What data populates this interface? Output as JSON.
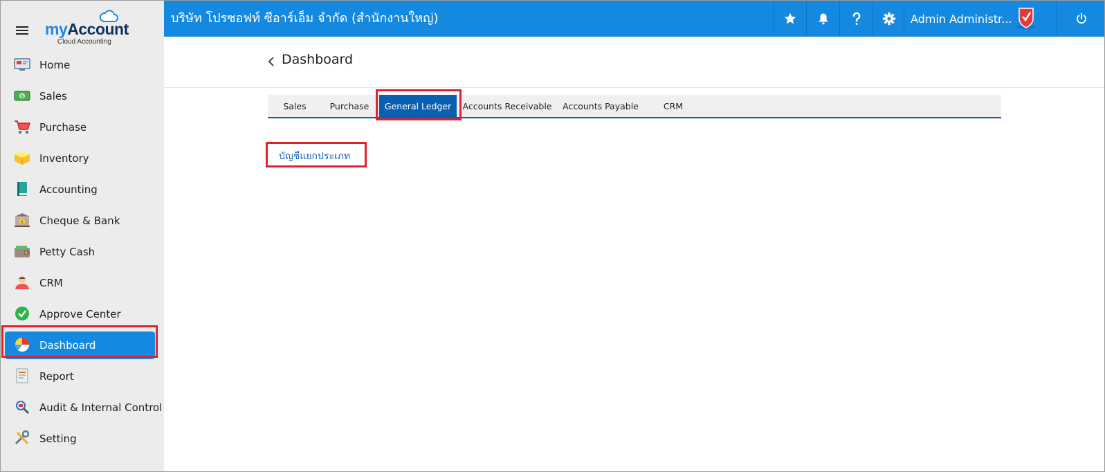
{
  "app": {
    "logo_my": "my",
    "logo_account": "Account",
    "logo_subtitle": "Cloud Accounting"
  },
  "topbar": {
    "company_name": "บริษัท โปรซอฟท์ ซีอาร์เอ็ม จำกัด (สำนักงานใหญ่)",
    "user_name": "Admin Administr...",
    "icons": [
      "star-icon",
      "bell-icon",
      "help-icon",
      "gear-icon",
      "power-icon"
    ]
  },
  "sidebar": {
    "items": [
      {
        "label": "Home",
        "icon": "home-icon"
      },
      {
        "label": "Sales",
        "icon": "money-icon"
      },
      {
        "label": "Purchase",
        "icon": "cart-icon"
      },
      {
        "label": "Inventory",
        "icon": "box-icon"
      },
      {
        "label": "Accounting",
        "icon": "book-icon"
      },
      {
        "label": "Cheque & Bank",
        "icon": "bank-icon"
      },
      {
        "label": "Petty Cash",
        "icon": "wallet-icon"
      },
      {
        "label": "CRM",
        "icon": "person-icon"
      },
      {
        "label": "Approve Center",
        "icon": "check-circle-icon"
      },
      {
        "label": "Dashboard",
        "icon": "pie-chart-icon",
        "active": true
      },
      {
        "label": "Report",
        "icon": "report-icon"
      },
      {
        "label": "Audit & Internal Control",
        "icon": "magnifier-icon"
      },
      {
        "label": "Setting",
        "icon": "tools-icon"
      }
    ]
  },
  "main": {
    "title": "Dashboard",
    "tabs": [
      {
        "label": "Sales"
      },
      {
        "label": "Purchase"
      },
      {
        "label": "General Ledger",
        "active": true
      },
      {
        "label": "Accounts Receivable"
      },
      {
        "label": "Accounts Payable"
      },
      {
        "label": "CRM"
      }
    ],
    "links": [
      {
        "label": "บัญชีแยกประเภท"
      }
    ]
  },
  "colors": {
    "accent": "#1589e0",
    "tab_active": "#0a5fb0",
    "highlight": "#e3202b",
    "link": "#1565c0"
  }
}
